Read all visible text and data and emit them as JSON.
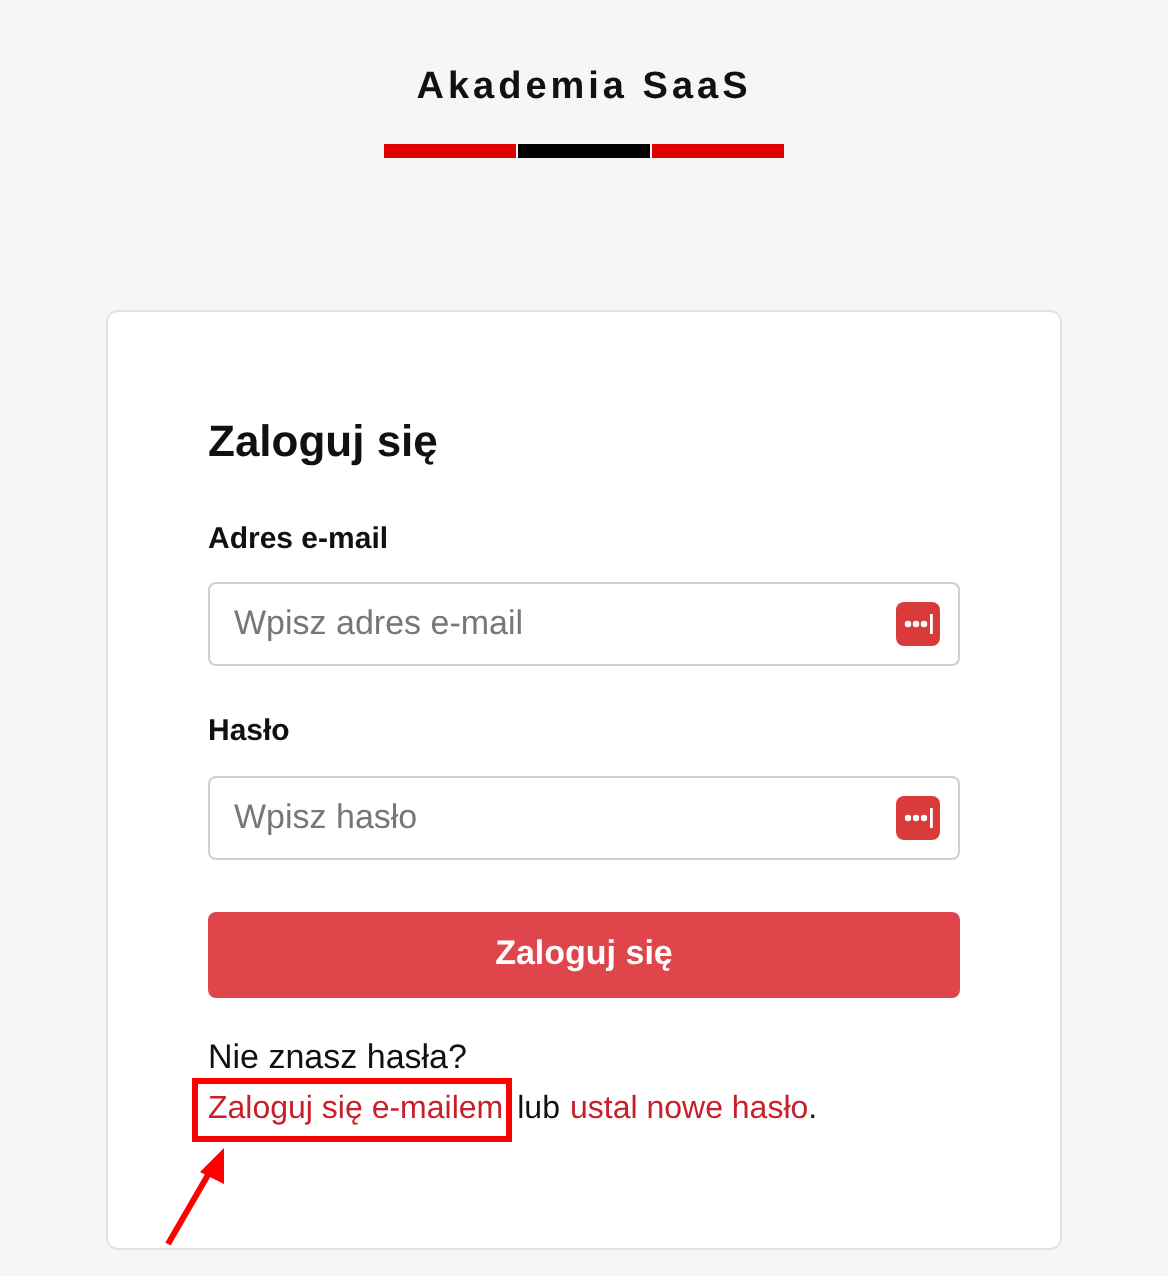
{
  "logo": {
    "text": "Akademia SaaS"
  },
  "card": {
    "title": "Zaloguj się",
    "fields": [
      {
        "label": "Adres e-mail",
        "placeholder": "Wpisz adres e-mail"
      },
      {
        "label": "Hasło",
        "placeholder": "Wpisz hasło"
      }
    ],
    "submit": "Zaloguj się",
    "help": {
      "question": "Nie znasz hasła?",
      "link_1": "Zaloguj się e-mailem",
      "middle": "lub",
      "link_2": "ustal nowe hasło",
      "end": "."
    }
  }
}
